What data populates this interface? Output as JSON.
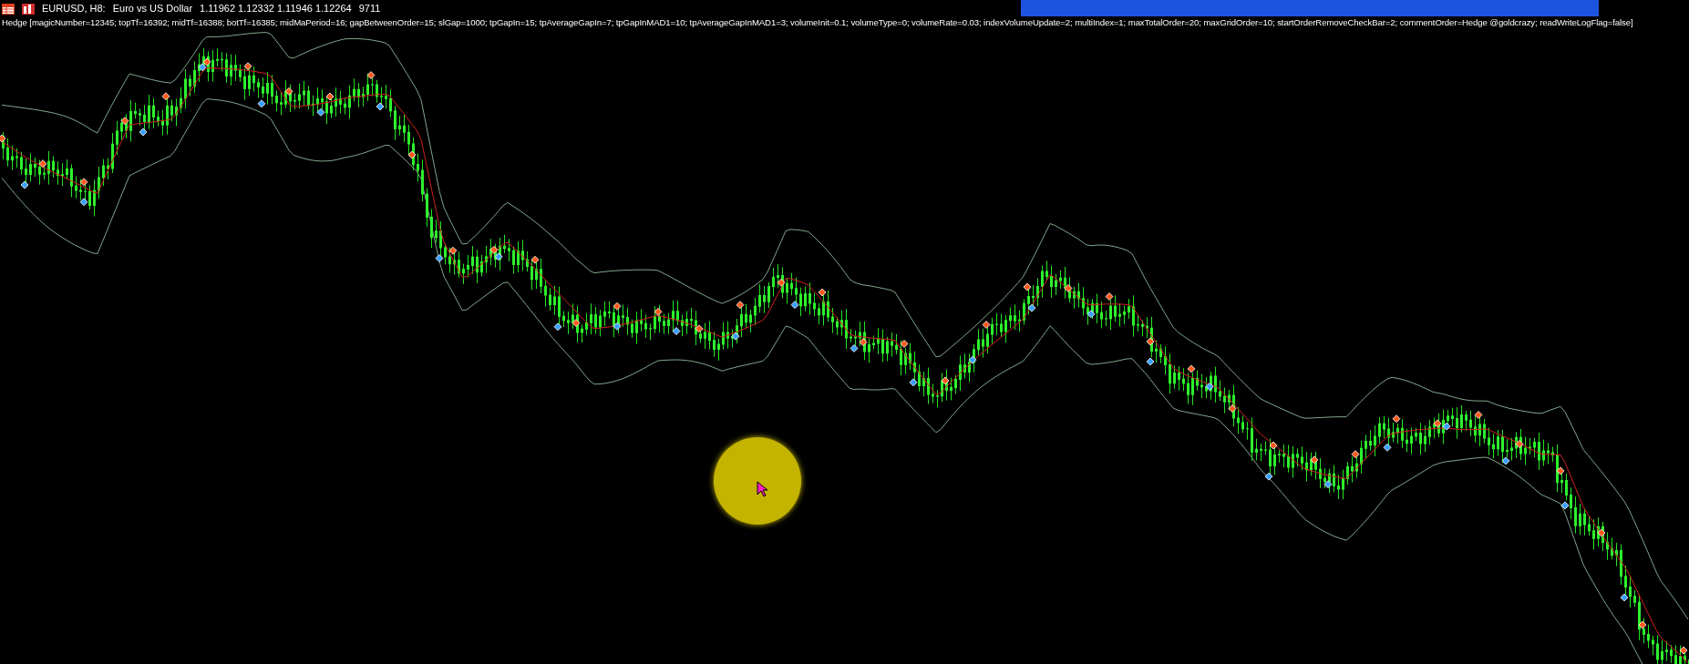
{
  "chart": {
    "symbol": "EURUSD, H8:",
    "description": "Euro vs US Dollar",
    "quotes": "1.11962 1.12332 1.11946 1.12264",
    "volume": "9711",
    "expert_info": "Hedge [magicNumber=12345; topTf=16392; midTf=16388; botTf=16385; midMaPeriod=16; gapBetweenOrder=15; slGap=1000; tpGapIn=15; tpAverageGapIn=7; tpGapInMAD1=10; tpAverageGapInMAD1=3; volumeInit=0.1; volumeType=0; volumeRate=0.03; indexVolumeUpdate=2; multiIndex=1; maxTotalOrder=20; maxGridOrder=10; startOrderRemoveCheckBar=2; commentOrder=Hedge @goldcrazy; readWriteLogFlag=false]"
  }
}
